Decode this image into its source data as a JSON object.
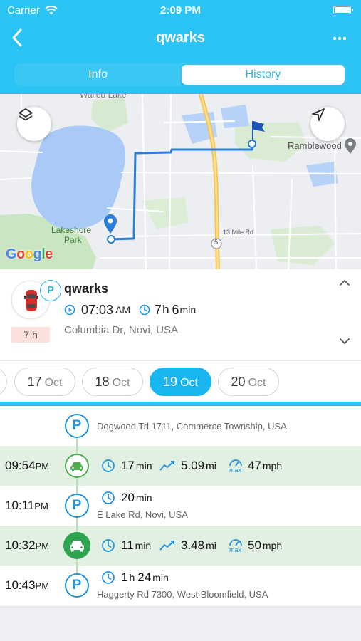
{
  "status_bar": {
    "carrier": "Carrier",
    "time": "2:09 PM"
  },
  "nav": {
    "title": "qwarks"
  },
  "tabs": [
    {
      "label": "Info",
      "selected": false
    },
    {
      "label": "History",
      "selected": true
    }
  ],
  "map": {
    "labels": {
      "town": "Ramblewood",
      "park_line1": "Lakeshore",
      "park_line2": "Park",
      "top": "Walled Lake",
      "road_13mile": "13 Mile Rd",
      "route5": "5"
    },
    "google": [
      "G",
      "o",
      "o",
      "g",
      "l",
      "e"
    ],
    "colors": {
      "water": "#a9c9f7",
      "park": "#c9e5c1",
      "route": "#2a7ddb",
      "highway": "#f6d36b"
    }
  },
  "vehicle": {
    "name": "qwarks",
    "status_letter": "P",
    "duration_badge": "7 h",
    "start_time": "07:03",
    "start_ampm": "AM",
    "duration_h": "7",
    "duration_h_unit": "h",
    "duration_m": "6",
    "duration_m_unit": "min",
    "address": "Columbia Dr, Novi, USA"
  },
  "dates": [
    {
      "day": "17",
      "month": "Oct",
      "active": false
    },
    {
      "day": "18",
      "month": "Oct",
      "active": false
    },
    {
      "day": "19",
      "month": "Oct",
      "active": true
    },
    {
      "day": "20",
      "month": "Oct",
      "active": false
    }
  ],
  "timeline": {
    "r0": {
      "type": "parking",
      "letter": "P",
      "address": "Dogwood Trl 1711, Commerce Township, USA"
    },
    "r1": {
      "type": "trip",
      "time": "09:54",
      "ampm": "PM",
      "duration": "17",
      "duration_unit": "min",
      "distance": "5.09",
      "distance_unit": "mi",
      "max_label": "max",
      "speed": "47",
      "speed_unit": "mph"
    },
    "r2": {
      "type": "parking",
      "letter": "P",
      "time": "10:11",
      "ampm": "PM",
      "duration": "20",
      "duration_unit": "min",
      "address": "E Lake Rd, Novi, USA"
    },
    "r3": {
      "type": "trip",
      "time": "10:32",
      "ampm": "PM",
      "duration": "11",
      "duration_unit": "min",
      "distance": "3.48",
      "distance_unit": "mi",
      "max_label": "max",
      "speed": "50",
      "speed_unit": "mph"
    },
    "r4": {
      "type": "parking",
      "letter": "P",
      "time": "10:43",
      "ampm": "PM",
      "duration_h": "1",
      "duration_h_unit": "h",
      "duration_m": "24",
      "duration_m_unit": "min",
      "address": "Haggerty Rd 7300, West Bloomfield, USA"
    }
  }
}
